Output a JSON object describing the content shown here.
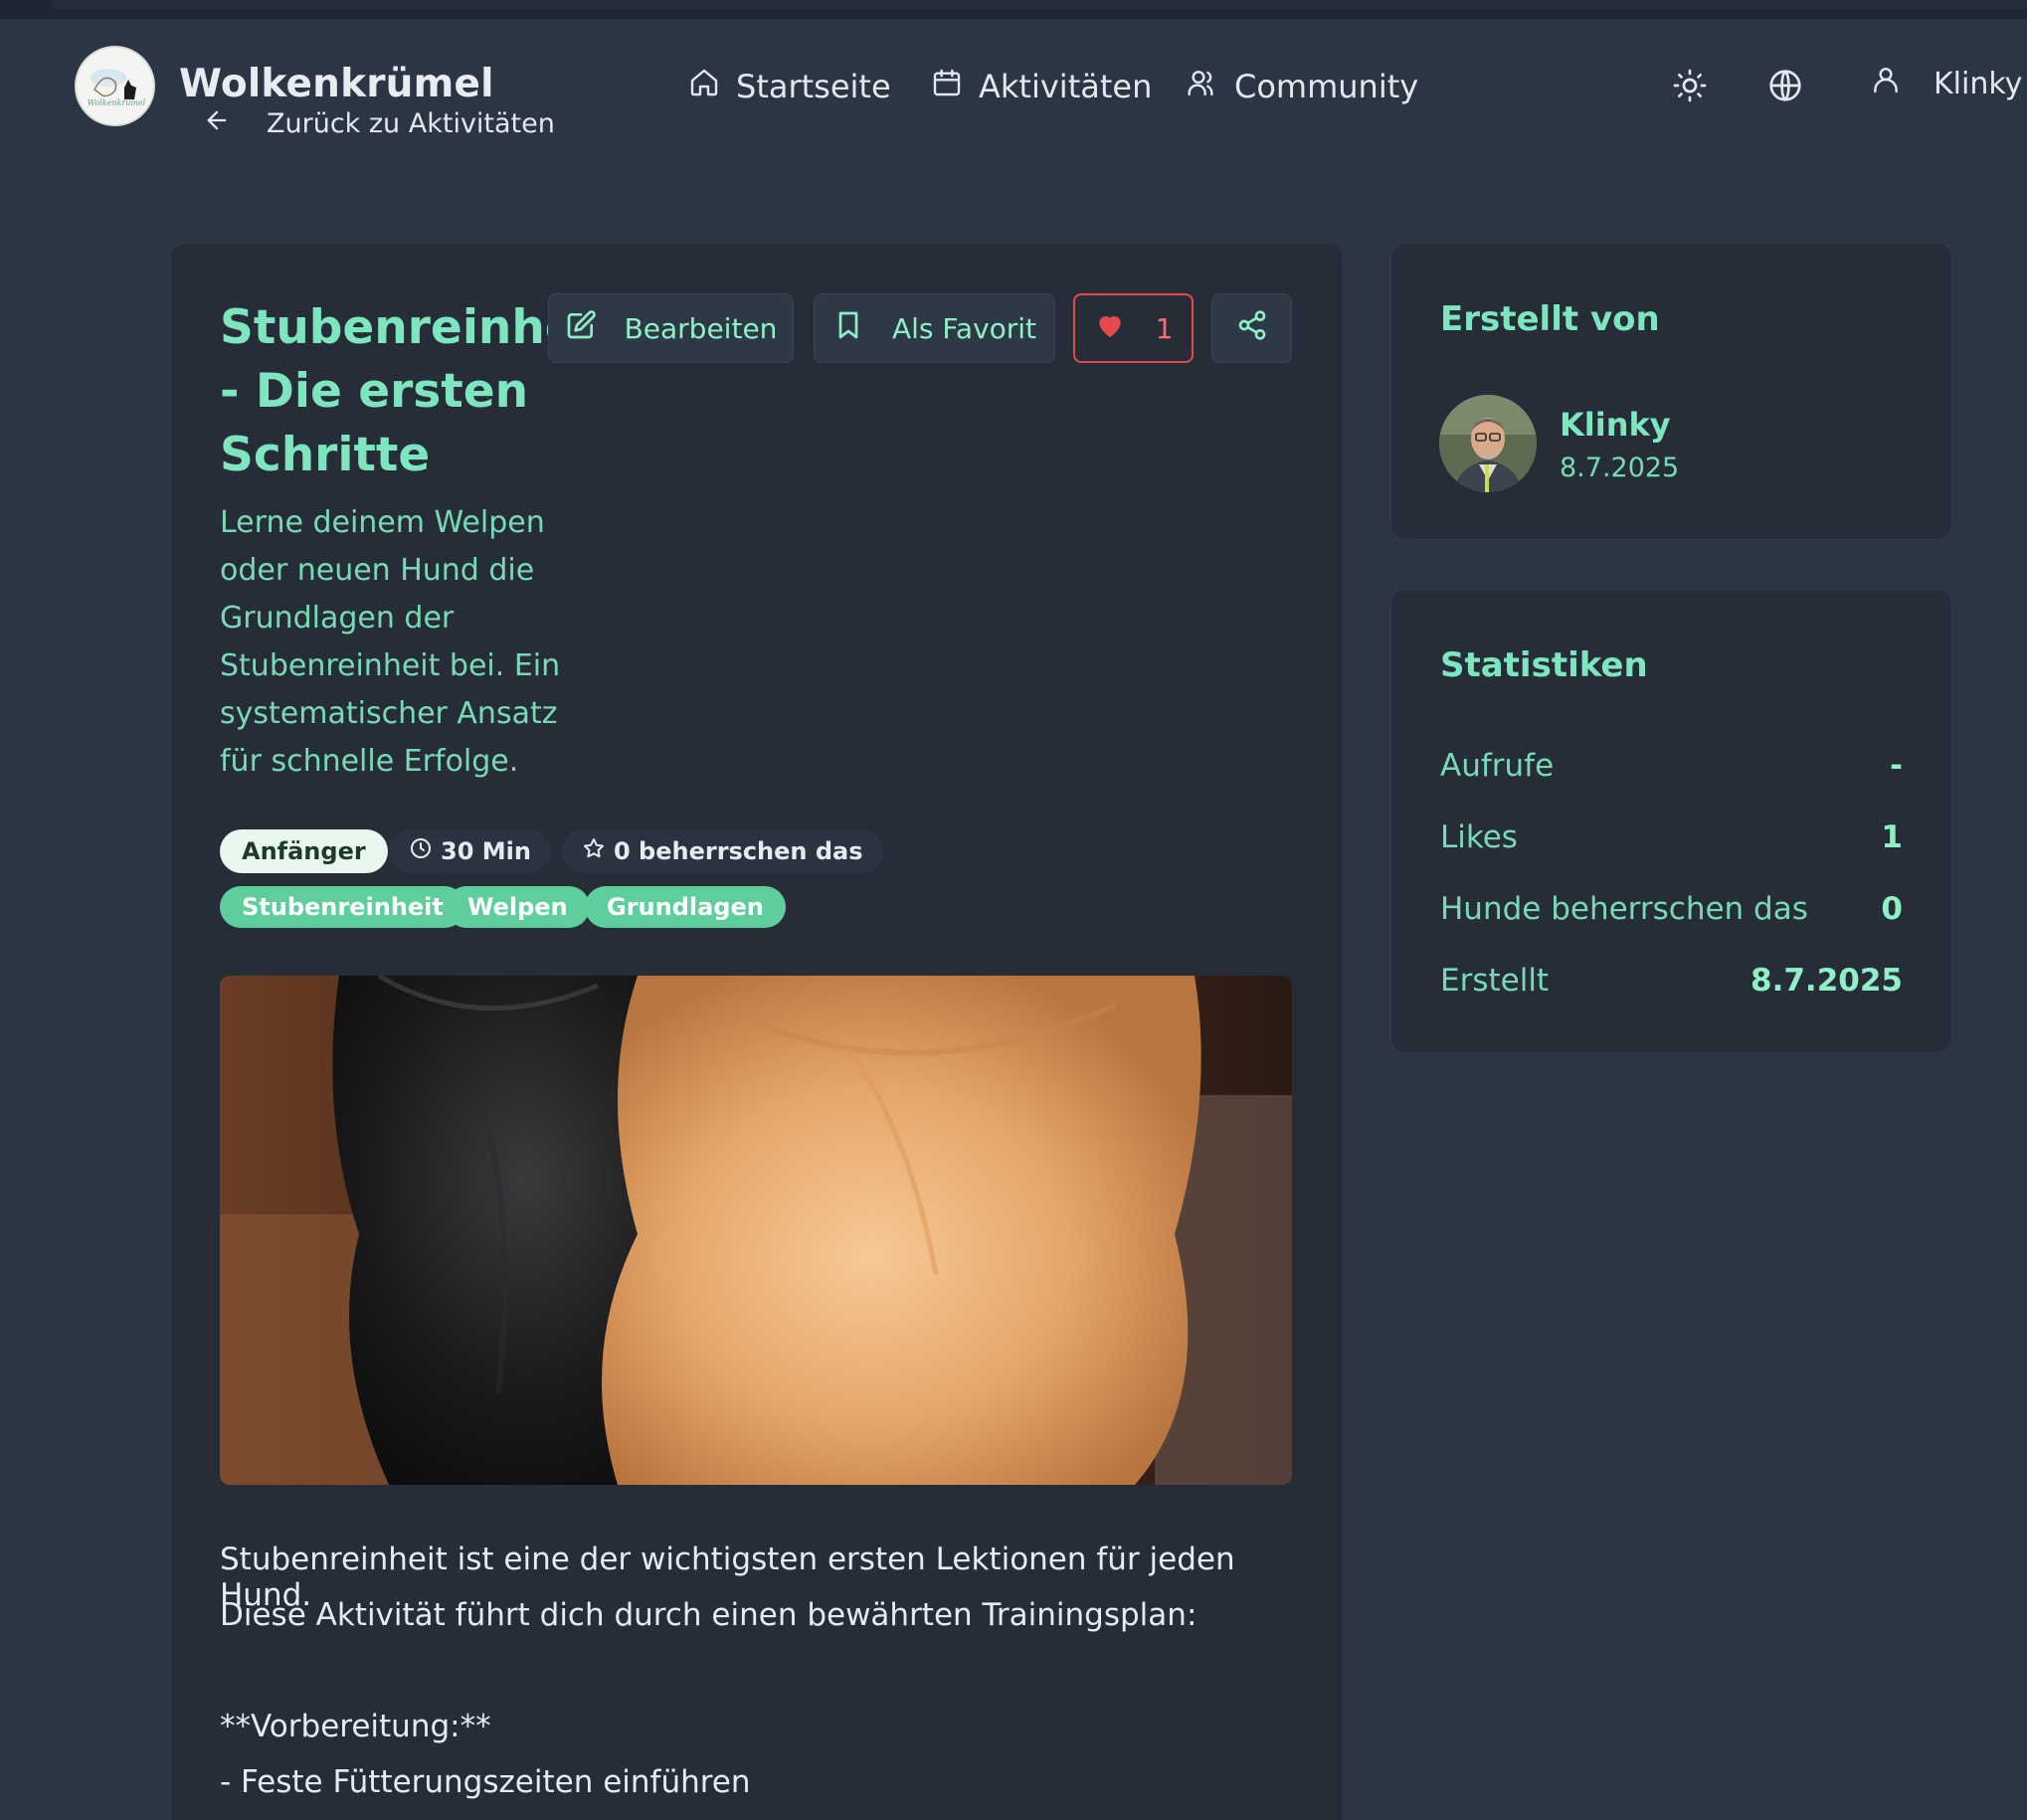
{
  "header": {
    "brand": "Wolkenkrümel",
    "back_label": "Zurück zu Aktivitäten",
    "nav": [
      {
        "label": "Startseite",
        "icon": "home-icon"
      },
      {
        "label": "Aktivitäten",
        "icon": "calendar-icon"
      },
      {
        "label": "Community",
        "icon": "users-icon"
      }
    ],
    "user_name": "Klinky"
  },
  "activity": {
    "title": "Stubenreinheit - Die ersten Schritte",
    "description": "Lerne deinem Welpen oder neuen Hund die Grundlagen der Stubenreinheit bei. Ein systematischer Ansatz für schnelle Erfolge.",
    "actions": {
      "edit": "Bearbeiten",
      "favorite": "Als Favorit",
      "likes": "1"
    },
    "level": "Anfänger",
    "duration": "30 Min",
    "mastered": "0 beherrschen das",
    "tags": [
      "Stubenreinheit",
      "Welpen",
      "Grundlagen"
    ],
    "content": [
      "Stubenreinheit ist eine der wichtigsten ersten Lektionen für jeden Hund.",
      "Diese Aktivität führt dich durch einen bewährten Trainingsplan:",
      "**Vorbereitung:**",
      "- Feste Fütterungszeiten einführen"
    ]
  },
  "creator": {
    "heading": "Erstellt von",
    "name": "Klinky",
    "date": "8.7.2025"
  },
  "stats": {
    "heading": "Statistiken",
    "rows": [
      {
        "label": "Aufrufe",
        "value": "-"
      },
      {
        "label": "Likes",
        "value": "1"
      },
      {
        "label": "Hunde beherrschen das",
        "value": "0"
      },
      {
        "label": "Erstellt",
        "value": "8.7.2025"
      }
    ]
  },
  "colors": {
    "background": "#2b3544",
    "card": "#262d39",
    "accent": "#7ee6be",
    "tag": "#5ecf9c",
    "like": "#e5484d"
  }
}
